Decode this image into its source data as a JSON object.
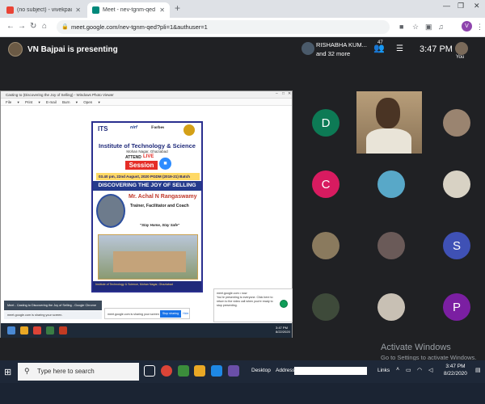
{
  "browser": {
    "tabs": [
      {
        "title": "(no subject) - vivekpachauri@its",
        "favicon_color": "#ea4335"
      },
      {
        "title": "Meet - nev-tgnm-qed",
        "favicon_color": "#00897b"
      }
    ],
    "url": "meet.google.com/nev-tgnm-qed?pli=1&authuser=1",
    "profile_initial": "V"
  },
  "meet": {
    "presenter_text": "VN Bajpai is presenting",
    "people_name": "RISHABHA KUM...",
    "people_more": "and 32 more",
    "people_count": "47",
    "time": "3:47 PM",
    "self_label": "You",
    "participants": [
      {
        "initial": "D",
        "color": "#0d7a55"
      },
      {
        "initial": "C",
        "color": "#d81b60"
      },
      {
        "initial": "S",
        "color": "#3f51b5"
      },
      {
        "initial": "P",
        "color": "#7b1fa2"
      }
    ]
  },
  "shared_screen": {
    "window_title": "Casting to (Discovering the Joy of Selling) - Windows Photo Viewer",
    "menu": "File ▾  Print ▾  E-mail  Burn ▾  Open ▾",
    "poster": {
      "logo_its": "ITS",
      "logo_nirf": "nirf",
      "logo_forbes": "Forbes",
      "institute": "Institute of Technology & Science",
      "city": "Mohan Nagar, Ghaziabad",
      "attend": "ATTEND",
      "live": "LIVE",
      "session": "Session",
      "date_line": "03.40 pm, 22nd August, 2020   PGDM (2019-21) Batch",
      "headline": "DISCOVERING THE JOY OF SELLING",
      "speaker": "Mr. Achal N Rangaswamy",
      "role": "Trainer, Facilitator and Coach",
      "slogan": "\"Stay Home, Stay Safe\"",
      "footer": "Institute of Technology & Science, Mohan Nagar, Ghaziabad"
    },
    "notification_line1": "Meet - Casting to Discovering the Joy of Selling - Google Chrome",
    "notification_line2": "meet.google.com is sharing your screen.",
    "share_text": "meet.google.com is sharing your screen",
    "stop_label": "Stop sharing",
    "hide_label": "Hide",
    "popup_title": "meet.google.com • now",
    "popup_body": "You're presenting to everyone. Click here to return to the video call when you're ready to stop presenting.",
    "inner_time": "3:47 PM",
    "inner_date": "8/22/2020"
  },
  "watermark": {
    "title": "Activate Windows",
    "subtitle": "Go to Settings to activate Windows."
  },
  "taskbar": {
    "search_placeholder": "Type here to search",
    "desktop_label": "Desktop",
    "address_label": "Address",
    "links_label": "Links",
    "time": "3:47 PM",
    "date": "8/22/2020"
  }
}
